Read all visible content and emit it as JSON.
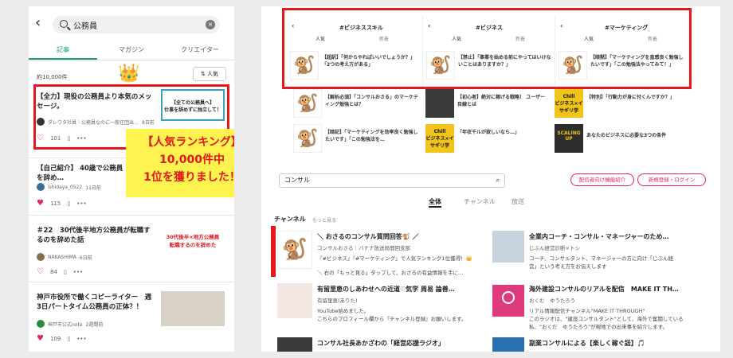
{
  "left": {
    "search_query": "公務員",
    "tabs": [
      "記事",
      "マガジン",
      "クリエイター"
    ],
    "result_count": "約10,000件",
    "crown": "👑",
    "sort_label": "人気",
    "articles": [
      {
        "title": "【全力】現役の公務員より本気のメッセージ。",
        "author": "ダレワタ社員｜公務員なのに一般往団出…",
        "time": "8日前",
        "likes": "101",
        "thumb_line1": "【全ての公務員へ】",
        "thumb_line2": "仕事を辞めずに独立して！"
      },
      {
        "title": "【自己紹介】 40歳で公務員を辞め…",
        "author": "ishidaya_0522",
        "time": "11日前",
        "likes": "115"
      },
      {
        "title": "＃22　30代後半地方公務員が転職するのを辞めた話",
        "author": "NAKASHIMA",
        "time": "6日前",
        "likes": "84",
        "thumb_line1": "30代後半×地方公務員",
        "thumb_line2": "転職するのを辞めた"
      },
      {
        "title": "神戸市役所で働くコピーライター　週3日パートタイム公務員の正体？！",
        "author": "神戸市公式note",
        "time": "2週間前",
        "likes": "109"
      }
    ],
    "promo_line1": "【人気ランキング】",
    "promo_line2": "10,000件中",
    "promo_line3": "1位を獲りました！"
  },
  "right": {
    "columns": [
      {
        "title": "#ビジネススキル",
        "tab1": "人気",
        "tab2": "新着"
      },
      {
        "title": "#ビジネス",
        "tab1": "人気",
        "tab2": "新着"
      },
      {
        "title": "#マーケティング",
        "tab1": "人気",
        "tab2": "新着"
      }
    ],
    "top_cards": [
      "【超訳】「何からやればいいでしょうか？」「2つの考え方がある」",
      "【禁止】「事業を始める前にやってはいけないことはありますか？」",
      "【暗黙】「マーケティングを直感良く勉強したいです」「この勉強法やってみて！」"
    ],
    "mid_cards": [
      "【解析必須】「コンサルおさる」のマーケティング勉強とは？",
      "【初心者】絶対に稼げる戦略！ ユーザー目線とは",
      "【特別】「行動力が身に付くんですか？」",
      "【暗記】「マーケティングを効率良く勉強したいです」「この勉強法を…",
      "「年収千ルが欲しいなら…」",
      "あなたのビジネスに必要な3つの条件"
    ],
    "chill_label1": "Chill",
    "chill_label2": "ビジネス×イサギリ学",
    "scaling_label1": "SCALING",
    "scaling_label2": "UP",
    "search_value": "コンサル",
    "btn_creator": "配信者向け機能紹介",
    "btn_signup": "新規登録・ログイン",
    "content_tabs": [
      "全体",
      "チャンネル",
      "放送"
    ],
    "channel_heading": "チャンネル",
    "channel_more": "もっと見る",
    "channels": [
      {
        "title": "＼ おさるのコンサル質問回答🐒 ／",
        "sub": "コンサルおさる｜バナナ放送局間回支部",
        "desc1": "『#ビジネス』『#マーケティング』で人気ランキング1位獲得！👑",
        "desc2": "＼ 右の「もっと見る」タップして、おさるの有益情報を手に…"
      },
      {
        "title": "全業内コーチ・コンサル・マネージャーのため…",
        "sub": "じぶん経営診断×トシ",
        "desc1": "コーチ、コンサルタント、マネージャーの方に向け「じぶん経",
        "desc2": "営」という考え方をお伝えします"
      },
      {
        "title": "有留里恵のしあわせへの近道♡気学 周易 論善…",
        "sub": "有留里恵(ありた)",
        "desc1": "YouTube始めました。",
        "desc2": "こちらのプロフィール欄から『チャンネル登録』お願いします。"
      },
      {
        "title": "海外建設コンサルのリアルを配信　MAKE IT TH…",
        "sub": "おくむ　ゆうたろう",
        "desc1": "リアル情報配信チャンネル\"MAKE IT THROUGH\"",
        "desc2": "このラジオは、\"建設コンサルタント\"として、海外で奮闘している私、\"おくだ　ゆうたろう\"が現地での出来事を紹介します。"
      },
      {
        "title": "コンサル社長あかざわの「経営応援ラジオ」",
        "sub": "",
        "desc1": "",
        "desc2": ""
      },
      {
        "title": "副業コンサルによる【楽しく稼ぐ話】🎵",
        "sub": "",
        "desc1": "",
        "desc2": ""
      }
    ]
  }
}
